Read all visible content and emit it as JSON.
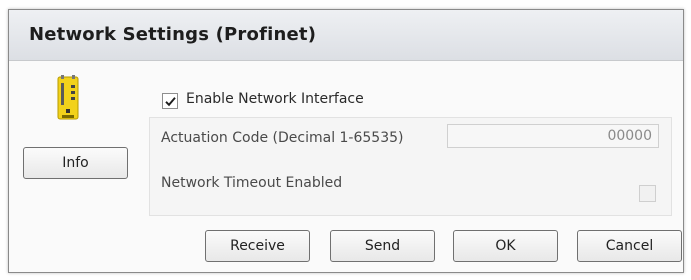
{
  "dialog": {
    "title": "Network Settings  (Profinet)"
  },
  "device": {
    "icon": "profinet-device-icon",
    "info_button": "Info"
  },
  "settings": {
    "enable_label": "Enable Network Interface",
    "enable_checked": true,
    "actuation_label": "Actuation Code (Decimal 1-65535)",
    "actuation_value": "00000",
    "timeout_label": "Network Timeout Enabled",
    "timeout_checked": false
  },
  "buttons": {
    "receive": "Receive",
    "send": "Send",
    "ok": "OK",
    "cancel": "Cancel"
  },
  "colors": {
    "device_yellow": "#f2d21b",
    "title_bar": "#e3e6ea"
  }
}
